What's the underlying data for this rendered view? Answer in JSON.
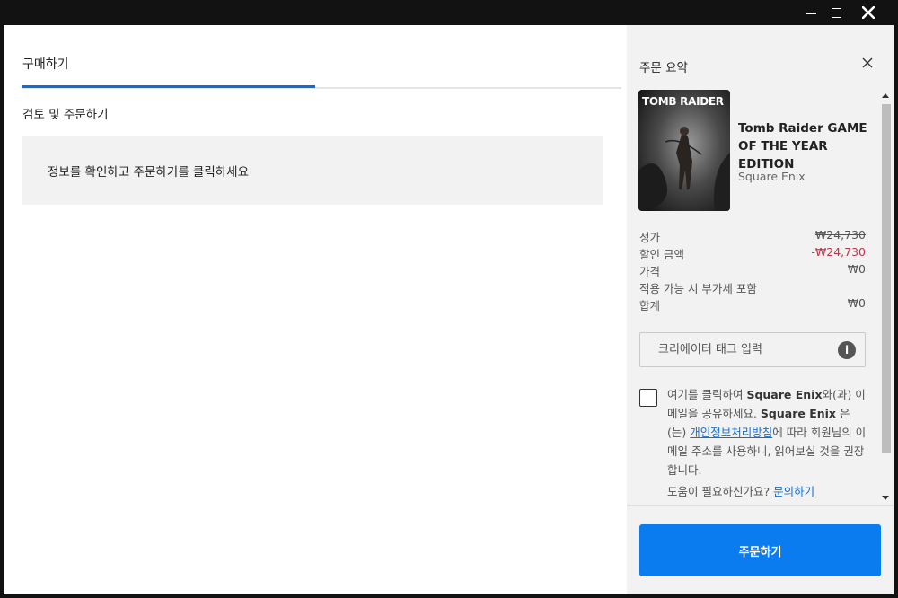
{
  "window": {
    "controls": [
      "minimize",
      "maximize",
      "close"
    ]
  },
  "main": {
    "title": "구매하기",
    "step_title": "검토 및 주문하기",
    "info_message": "정보를 확인하고 주문하기를 클릭하세요"
  },
  "summary": {
    "title": "주문 요약",
    "cover_text": "TOMB RAIDER",
    "game_name": "Tomb Raider GAME OF THE YEAR EDITION",
    "publisher": "Square Enix",
    "prices": [
      {
        "label": "정가",
        "value": "₩24,730"
      },
      {
        "label": "할인 금액",
        "value": "-₩24,730"
      },
      {
        "label": "가격",
        "value": "₩0"
      },
      {
        "label": "적용 가능 시 부가세 포함",
        "value": ""
      },
      {
        "label": "합계",
        "value": "₩0"
      }
    ],
    "creator_tag_placeholder": "크리에이터 태그 입력",
    "info_icon_glyph": "i",
    "consent": {
      "part1": "여기를 클릭하여 ",
      "company1": "Square Enix",
      "part2": "와(과) 이메일을 공유하세요. ",
      "company2": "Square Enix",
      "part3": " 은(는) ",
      "privacy_link": "개인정보처리방침",
      "part4": "에 따라 회원님의 이메일 주소를 사용하니, 읽어보실 것을 권장합니다."
    },
    "help_text": "도움이 필요하신가요? ",
    "help_link": "문의하기",
    "order_button": "주문하기"
  },
  "colors": {
    "accent": "#0f6fd9",
    "button": "#0a7cf0",
    "discount": "#c2334d",
    "panel": "#f2f2f2",
    "chrome": "#121212"
  }
}
